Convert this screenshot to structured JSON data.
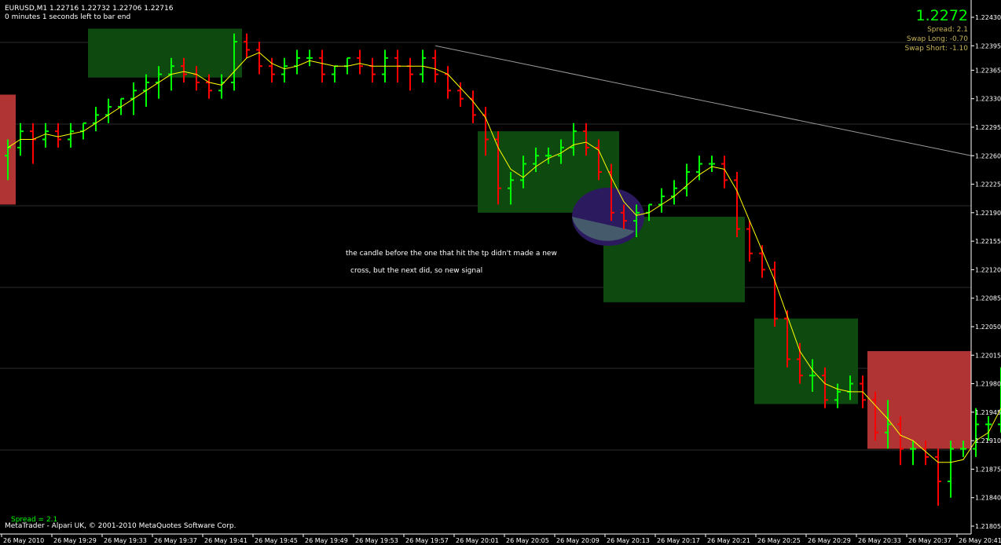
{
  "header": {
    "symbol_line": "EURUSD,M1  1.22716 1.22732 1.22706 1.22716",
    "timer_line": "0 minutes 1 seconds left to bar end"
  },
  "info_panel": {
    "price": "1.2272",
    "spread": "Spread: 2.1",
    "swap_long": "Swap Long: -0.70",
    "swap_short": "Swap Short: -1.10"
  },
  "annotation": {
    "line1": "the candle before the one that hit the tp didn't made a new",
    "line2": "cross, but the next did, so new signal"
  },
  "footer": {
    "spread_label": "Spread =   2.1",
    "copyright": "MetaTrader - Alpari UK, © 2001-2010 MetaQuotes Software Corp."
  },
  "colors": {
    "background": "#000000",
    "bull_bar": "#00ff00",
    "bear_bar": "#ff0000",
    "moving_average": "#ffff00",
    "buy_zone": "#0e4a10",
    "sell_zone": "#b03434",
    "highlight_circle": "#2c1a5e",
    "trendline": "#9a9a9a",
    "price_text": "#00ff00",
    "swap_text": "#c8b45a"
  },
  "chart_data": {
    "type": "ohlc",
    "y_ticks": [
      "1.22430",
      "1.22395",
      "1.22365",
      "1.22330",
      "1.22295",
      "1.22260",
      "1.22225",
      "1.22190",
      "1.22155",
      "1.22120",
      "1.22085",
      "1.22050",
      "1.22015",
      "1.21980",
      "1.21945",
      "1.21910",
      "1.21875",
      "1.21840",
      "1.21805"
    ],
    "ylim": [
      1.21805,
      1.2243
    ],
    "x_ticks": [
      "26 May 2010",
      "26 May 19:29",
      "26 May 19:33",
      "26 May 19:37",
      "26 May 19:41",
      "26 May 19:45",
      "26 May 19:49",
      "26 May 19:53",
      "26 May 19:57",
      "26 May 20:01",
      "26 May 20:05",
      "26 May 20:09",
      "26 May 20:13",
      "26 May 20:17",
      "26 May 20:21",
      "26 May 20:25",
      "26 May 20:29",
      "26 May 20:33",
      "26 May 20:37",
      "26 May 20:41"
    ],
    "grid": true,
    "bars": [
      {
        "o": 1.2226,
        "h": 1.2228,
        "l": 1.2223,
        "c": 1.2227
      },
      {
        "o": 1.2227,
        "h": 1.223,
        "l": 1.2226,
        "c": 1.2229
      },
      {
        "o": 1.2229,
        "h": 1.223,
        "l": 1.2225,
        "c": 1.2228
      },
      {
        "o": 1.2228,
        "h": 1.223,
        "l": 1.2227,
        "c": 1.2229
      },
      {
        "o": 1.2229,
        "h": 1.223,
        "l": 1.2227,
        "c": 1.2228
      },
      {
        "o": 1.2228,
        "h": 1.223,
        "l": 1.2227,
        "c": 1.2229
      },
      {
        "o": 1.2229,
        "h": 1.223,
        "l": 1.2228,
        "c": 1.223
      },
      {
        "o": 1.223,
        "h": 1.2232,
        "l": 1.2229,
        "c": 1.2231
      },
      {
        "o": 1.2231,
        "h": 1.2233,
        "l": 1.223,
        "c": 1.2232
      },
      {
        "o": 1.2232,
        "h": 1.2233,
        "l": 1.2231,
        "c": 1.2233
      },
      {
        "o": 1.2233,
        "h": 1.2235,
        "l": 1.2231,
        "c": 1.2234
      },
      {
        "o": 1.2234,
        "h": 1.2236,
        "l": 1.2232,
        "c": 1.2235
      },
      {
        "o": 1.2235,
        "h": 1.2237,
        "l": 1.2233,
        "c": 1.2236
      },
      {
        "o": 1.2236,
        "h": 1.2238,
        "l": 1.2234,
        "c": 1.2237
      },
      {
        "o": 1.2237,
        "h": 1.2238,
        "l": 1.2235,
        "c": 1.2236
      },
      {
        "o": 1.2236,
        "h": 1.2237,
        "l": 1.2234,
        "c": 1.2235
      },
      {
        "o": 1.2235,
        "h": 1.2236,
        "l": 1.2233,
        "c": 1.2234
      },
      {
        "o": 1.2234,
        "h": 1.2236,
        "l": 1.2233,
        "c": 1.2235
      },
      {
        "o": 1.2235,
        "h": 1.2241,
        "l": 1.2234,
        "c": 1.224
      },
      {
        "o": 1.224,
        "h": 1.2241,
        "l": 1.2238,
        "c": 1.2239
      },
      {
        "o": 1.2239,
        "h": 1.224,
        "l": 1.2236,
        "c": 1.2237
      },
      {
        "o": 1.2237,
        "h": 1.2238,
        "l": 1.2235,
        "c": 1.2236
      },
      {
        "o": 1.2236,
        "h": 1.2238,
        "l": 1.2235,
        "c": 1.2237
      },
      {
        "o": 1.2237,
        "h": 1.2239,
        "l": 1.2236,
        "c": 1.2238
      },
      {
        "o": 1.2238,
        "h": 1.2239,
        "l": 1.2237,
        "c": 1.2238
      },
      {
        "o": 1.2238,
        "h": 1.2239,
        "l": 1.2235,
        "c": 1.2236
      },
      {
        "o": 1.2236,
        "h": 1.2237,
        "l": 1.2235,
        "c": 1.2237
      },
      {
        "o": 1.2237,
        "h": 1.2238,
        "l": 1.2236,
        "c": 1.2238
      },
      {
        "o": 1.2238,
        "h": 1.2239,
        "l": 1.2236,
        "c": 1.2237
      },
      {
        "o": 1.2237,
        "h": 1.2238,
        "l": 1.2235,
        "c": 1.2236
      },
      {
        "o": 1.2236,
        "h": 1.2239,
        "l": 1.2235,
        "c": 1.2238
      },
      {
        "o": 1.2238,
        "h": 1.2239,
        "l": 1.2235,
        "c": 1.2237
      },
      {
        "o": 1.2237,
        "h": 1.2238,
        "l": 1.2234,
        "c": 1.2236
      },
      {
        "o": 1.2236,
        "h": 1.2239,
        "l": 1.2235,
        "c": 1.2238
      },
      {
        "o": 1.2238,
        "h": 1.2239,
        "l": 1.2235,
        "c": 1.2236
      },
      {
        "o": 1.2236,
        "h": 1.2237,
        "l": 1.2233,
        "c": 1.2234
      },
      {
        "o": 1.2234,
        "h": 1.2235,
        "l": 1.2232,
        "c": 1.2233
      },
      {
        "o": 1.2233,
        "h": 1.2234,
        "l": 1.223,
        "c": 1.2231
      },
      {
        "o": 1.2231,
        "h": 1.2232,
        "l": 1.2226,
        "c": 1.2228
      },
      {
        "o": 1.2228,
        "h": 1.2229,
        "l": 1.222,
        "c": 1.2222
      },
      {
        "o": 1.2222,
        "h": 1.2224,
        "l": 1.222,
        "c": 1.2223
      },
      {
        "o": 1.2223,
        "h": 1.2226,
        "l": 1.2222,
        "c": 1.2225
      },
      {
        "o": 1.2225,
        "h": 1.2227,
        "l": 1.2224,
        "c": 1.2226
      },
      {
        "o": 1.2226,
        "h": 1.2227,
        "l": 1.2225,
        "c": 1.2226
      },
      {
        "o": 1.2226,
        "h": 1.2228,
        "l": 1.2225,
        "c": 1.2227
      },
      {
        "o": 1.2227,
        "h": 1.223,
        "l": 1.2226,
        "c": 1.2229
      },
      {
        "o": 1.2229,
        "h": 1.223,
        "l": 1.2226,
        "c": 1.2227
      },
      {
        "o": 1.2227,
        "h": 1.2228,
        "l": 1.2223,
        "c": 1.2224
      },
      {
        "o": 1.2224,
        "h": 1.2225,
        "l": 1.2218,
        "c": 1.2219
      },
      {
        "o": 1.2219,
        "h": 1.222,
        "l": 1.2217,
        "c": 1.2218
      },
      {
        "o": 1.2218,
        "h": 1.222,
        "l": 1.2216,
        "c": 1.2219
      },
      {
        "o": 1.2219,
        "h": 1.222,
        "l": 1.2218,
        "c": 1.222
      },
      {
        "o": 1.222,
        "h": 1.2222,
        "l": 1.2219,
        "c": 1.2221
      },
      {
        "o": 1.2221,
        "h": 1.2223,
        "l": 1.222,
        "c": 1.2222
      },
      {
        "o": 1.2222,
        "h": 1.2225,
        "l": 1.2221,
        "c": 1.2224
      },
      {
        "o": 1.2224,
        "h": 1.2226,
        "l": 1.2223,
        "c": 1.2225
      },
      {
        "o": 1.2225,
        "h": 1.2226,
        "l": 1.2224,
        "c": 1.2225
      },
      {
        "o": 1.2225,
        "h": 1.2226,
        "l": 1.2222,
        "c": 1.2223
      },
      {
        "o": 1.2223,
        "h": 1.2224,
        "l": 1.2216,
        "c": 1.2217
      },
      {
        "o": 1.2217,
        "h": 1.2218,
        "l": 1.2213,
        "c": 1.2214
      },
      {
        "o": 1.2214,
        "h": 1.2215,
        "l": 1.2211,
        "c": 1.2212
      },
      {
        "o": 1.2212,
        "h": 1.2213,
        "l": 1.2205,
        "c": 1.2206
      },
      {
        "o": 1.2206,
        "h": 1.2207,
        "l": 1.22,
        "c": 1.2201
      },
      {
        "o": 1.2201,
        "h": 1.2203,
        "l": 1.2198,
        "c": 1.2199
      },
      {
        "o": 1.2199,
        "h": 1.2201,
        "l": 1.2197,
        "c": 1.2199
      },
      {
        "o": 1.2199,
        "h": 1.22,
        "l": 1.2195,
        "c": 1.2196
      },
      {
        "o": 1.2196,
        "h": 1.2198,
        "l": 1.2195,
        "c": 1.2197
      },
      {
        "o": 1.2197,
        "h": 1.2199,
        "l": 1.2196,
        "c": 1.2198
      },
      {
        "o": 1.2198,
        "h": 1.2199,
        "l": 1.2195,
        "c": 1.2196
      },
      {
        "o": 1.2196,
        "h": 1.2197,
        "l": 1.2191,
        "c": 1.2192
      },
      {
        "o": 1.2192,
        "h": 1.2196,
        "l": 1.219,
        "c": 1.2193
      },
      {
        "o": 1.2193,
        "h": 1.2194,
        "l": 1.2188,
        "c": 1.219
      },
      {
        "o": 1.219,
        "h": 1.2191,
        "l": 1.2188,
        "c": 1.219
      },
      {
        "o": 1.219,
        "h": 1.2191,
        "l": 1.2188,
        "c": 1.2189
      },
      {
        "o": 1.2189,
        "h": 1.219,
        "l": 1.2183,
        "c": 1.2186
      },
      {
        "o": 1.2186,
        "h": 1.2191,
        "l": 1.2184,
        "c": 1.219
      },
      {
        "o": 1.219,
        "h": 1.2191,
        "l": 1.2189,
        "c": 1.219
      },
      {
        "o": 1.219,
        "h": 1.2195,
        "l": 1.2189,
        "c": 1.2193
      },
      {
        "o": 1.2193,
        "h": 1.2194,
        "l": 1.2191,
        "c": 1.2193
      },
      {
        "o": 1.2193,
        "h": 1.22,
        "l": 1.2192,
        "c": 1.2199
      }
    ],
    "zones": [
      {
        "kind": "buy",
        "bar_start": 7,
        "bar_end": 18,
        "top": 1.22416,
        "bottom": 1.22356
      },
      {
        "kind": "buy",
        "bar_start": 38,
        "bar_end": 48,
        "top": 1.2229,
        "bottom": 1.2219
      },
      {
        "kind": "buy",
        "bar_start": 48,
        "bar_end": 58,
        "top": 1.22185,
        "bottom": 1.2208
      },
      {
        "kind": "buy",
        "bar_start": 60,
        "bar_end": 67,
        "top": 1.2206,
        "bottom": 1.21955
      },
      {
        "kind": "sell",
        "bar_start": 0,
        "bar_end": 0,
        "top": 1.22335,
        "bottom": 1.222
      },
      {
        "kind": "sell",
        "bar_start": 69,
        "bar_end": 78,
        "top": 1.2202,
        "bottom": 1.219
      }
    ],
    "trendline": {
      "bar_start": 34,
      "price_start": 1.22395,
      "bar_end": 78,
      "price_end": 1.2226
    },
    "highlight": {
      "bar": 48,
      "price": 1.22185
    }
  }
}
